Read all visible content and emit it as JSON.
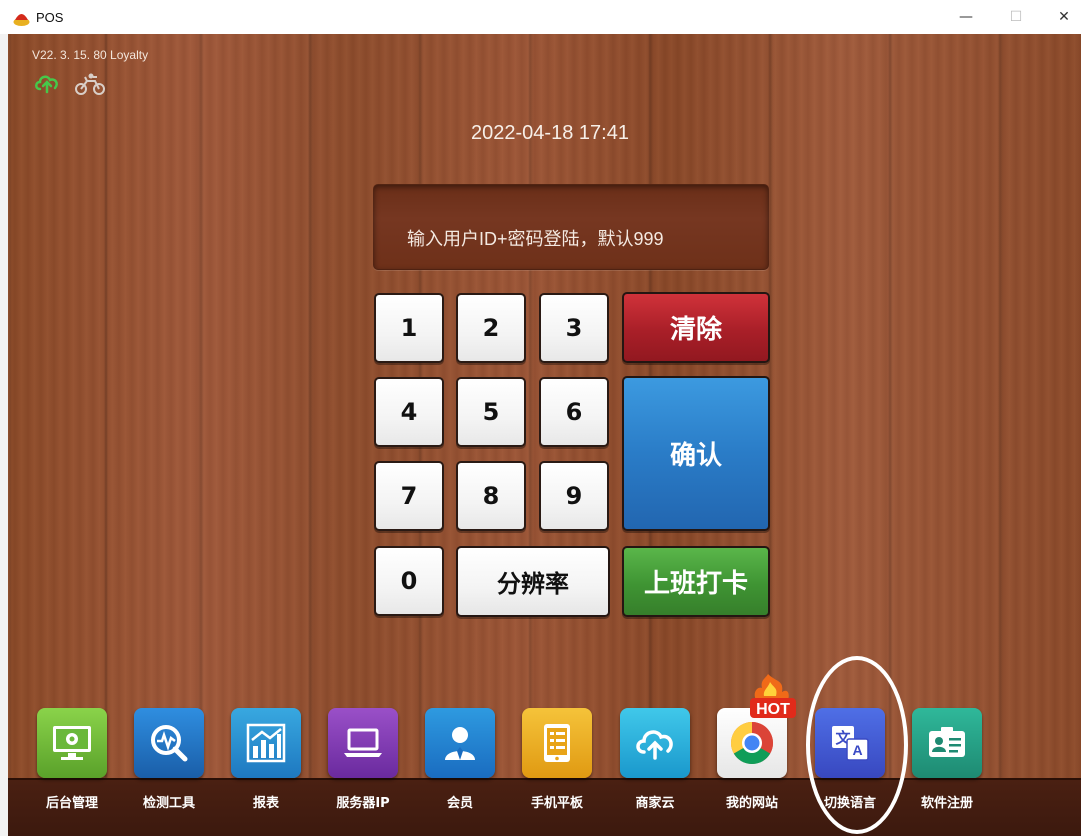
{
  "window": {
    "title": "POS",
    "minimize": "—",
    "maximize": "☐",
    "close": "✕"
  },
  "header": {
    "version": "V22. 3. 15. 80 Loyalty",
    "datetime": "2022-04-18 17:41"
  },
  "login": {
    "prompt": "输入用户ID+密码登陆，默认999"
  },
  "keypad": {
    "keys": [
      "1",
      "2",
      "3",
      "4",
      "5",
      "6",
      "7",
      "8",
      "9",
      "0"
    ],
    "resolution": "分辨率",
    "clear": "清除",
    "confirm": "确认",
    "clock_in": "上班打卡"
  },
  "dock": {
    "items": [
      {
        "label": "后台管理",
        "icon": "monitor-gear-icon"
      },
      {
        "label": "检测工具",
        "icon": "magnifier-pulse-icon"
      },
      {
        "label": "报表",
        "icon": "bar-chart-icon"
      },
      {
        "label": "服务器IP",
        "icon": "laptop-icon"
      },
      {
        "label": "会员",
        "icon": "user-icon"
      },
      {
        "label": "手机平板",
        "icon": "tablet-icon"
      },
      {
        "label": "商家云",
        "icon": "cloud-upload-icon"
      },
      {
        "label": "我的网站",
        "icon": "chrome-icon"
      },
      {
        "label": "切换语言",
        "icon": "translate-icon"
      },
      {
        "label": "软件注册",
        "icon": "id-card-icon"
      }
    ],
    "hot_badge": "HOT"
  }
}
